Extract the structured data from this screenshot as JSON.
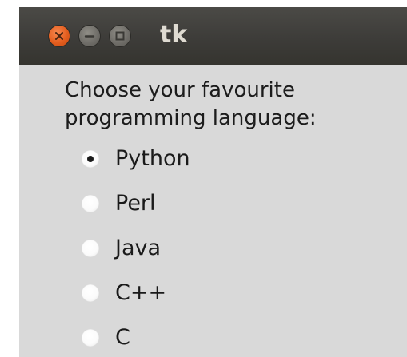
{
  "window": {
    "title": "tk",
    "buttons": [
      {
        "name": "close",
        "glyph": "×",
        "color": "#e35d1e"
      },
      {
        "name": "minimize",
        "glyph": "–",
        "color": "#6d6b66"
      },
      {
        "name": "maximize",
        "glyph": "□",
        "color": "#6d6b66"
      }
    ]
  },
  "prompt": {
    "line1": "Choose your favourite",
    "line2": "programming language:"
  },
  "options": [
    {
      "label": "Python",
      "selected": true
    },
    {
      "label": "Perl",
      "selected": false
    },
    {
      "label": "Java",
      "selected": false
    },
    {
      "label": "C++",
      "selected": false
    },
    {
      "label": "C",
      "selected": false
    }
  ],
  "colors": {
    "titlebar": "#3d3c39",
    "background": "#d9d9d9",
    "text": "#1a1a1a",
    "title_text": "#dfdbd2"
  }
}
